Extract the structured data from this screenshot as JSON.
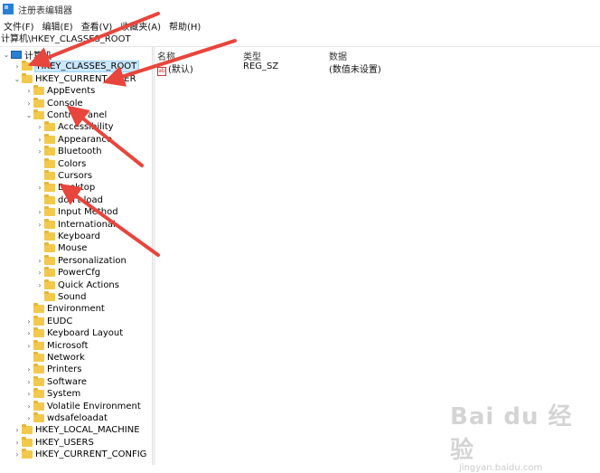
{
  "window": {
    "title": "注册表编辑器"
  },
  "menu": [
    "文件(F)",
    "编辑(E)",
    "查看(V)",
    "收藏夹(A)",
    "帮助(H)"
  ],
  "address": "计算机\\HKEY_CLASSES_ROOT",
  "tree": [
    {
      "label": "计算机",
      "depth": 0,
      "chevron": "v",
      "icon": "computer"
    },
    {
      "label": "HKEY_CLASSES_ROOT",
      "depth": 1,
      "chevron": ">",
      "icon": "folder",
      "selected": true
    },
    {
      "label": "HKEY_CURRENT_USER",
      "depth": 1,
      "chevron": "v",
      "icon": "folder"
    },
    {
      "label": "AppEvents",
      "depth": 2,
      "chevron": ">",
      "icon": "folder"
    },
    {
      "label": "Console",
      "depth": 2,
      "chevron": ">",
      "icon": "folder"
    },
    {
      "label": "Control Panel",
      "depth": 2,
      "chevron": "v",
      "icon": "folder"
    },
    {
      "label": "Accessibility",
      "depth": 3,
      "chevron": ">",
      "icon": "folder"
    },
    {
      "label": "Appearance",
      "depth": 3,
      "chevron": ">",
      "icon": "folder"
    },
    {
      "label": "Bluetooth",
      "depth": 3,
      "chevron": ">",
      "icon": "folder"
    },
    {
      "label": "Colors",
      "depth": 3,
      "chevron": "",
      "icon": "folder"
    },
    {
      "label": "Cursors",
      "depth": 3,
      "chevron": "",
      "icon": "folder"
    },
    {
      "label": "Desktop",
      "depth": 3,
      "chevron": ">",
      "icon": "folder"
    },
    {
      "label": "don't load",
      "depth": 3,
      "chevron": "",
      "icon": "folder"
    },
    {
      "label": "Input Method",
      "depth": 3,
      "chevron": ">",
      "icon": "folder"
    },
    {
      "label": "International",
      "depth": 3,
      "chevron": ">",
      "icon": "folder"
    },
    {
      "label": "Keyboard",
      "depth": 3,
      "chevron": "",
      "icon": "folder"
    },
    {
      "label": "Mouse",
      "depth": 3,
      "chevron": "",
      "icon": "folder"
    },
    {
      "label": "Personalization",
      "depth": 3,
      "chevron": ">",
      "icon": "folder"
    },
    {
      "label": "PowerCfg",
      "depth": 3,
      "chevron": ">",
      "icon": "folder"
    },
    {
      "label": "Quick Actions",
      "depth": 3,
      "chevron": ">",
      "icon": "folder"
    },
    {
      "label": "Sound",
      "depth": 3,
      "chevron": "",
      "icon": "folder"
    },
    {
      "label": "Environment",
      "depth": 2,
      "chevron": "",
      "icon": "folder"
    },
    {
      "label": "EUDC",
      "depth": 2,
      "chevron": ">",
      "icon": "folder"
    },
    {
      "label": "Keyboard Layout",
      "depth": 2,
      "chevron": ">",
      "icon": "folder"
    },
    {
      "label": "Microsoft",
      "depth": 2,
      "chevron": ">",
      "icon": "folder"
    },
    {
      "label": "Network",
      "depth": 2,
      "chevron": "",
      "icon": "folder"
    },
    {
      "label": "Printers",
      "depth": 2,
      "chevron": ">",
      "icon": "folder"
    },
    {
      "label": "Software",
      "depth": 2,
      "chevron": ">",
      "icon": "folder"
    },
    {
      "label": "System",
      "depth": 2,
      "chevron": ">",
      "icon": "folder"
    },
    {
      "label": "Volatile Environment",
      "depth": 2,
      "chevron": ">",
      "icon": "folder"
    },
    {
      "label": "wdsafeloadat",
      "depth": 2,
      "chevron": ">",
      "icon": "folder"
    },
    {
      "label": "HKEY_LOCAL_MACHINE",
      "depth": 1,
      "chevron": ">",
      "icon": "folder"
    },
    {
      "label": "HKEY_USERS",
      "depth": 1,
      "chevron": ">",
      "icon": "folder"
    },
    {
      "label": "HKEY_CURRENT_CONFIG",
      "depth": 1,
      "chevron": ">",
      "icon": "folder"
    }
  ],
  "list": {
    "columns": [
      "名称",
      "类型",
      "数据"
    ],
    "rows": [
      {
        "name": "(默认)",
        "type": "REG_SZ",
        "data": "(数值未设置)",
        "icon": "string-value-icon"
      }
    ]
  },
  "watermark": {
    "logo": "Bai du 经验",
    "sub": "jingyan.baidu.com"
  },
  "colors": {
    "arrow": "#e8453c",
    "selection": "#cce8ff",
    "folder": "#f2c94c"
  }
}
